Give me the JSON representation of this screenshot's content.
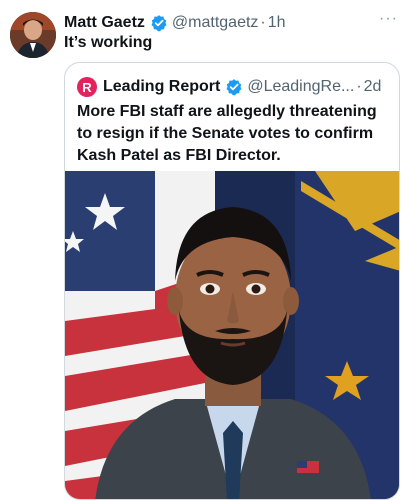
{
  "tweet": {
    "author_name": "Matt Gaetz",
    "handle": "@mattgaetz",
    "separator": "·",
    "age": "1h",
    "text": "It’s working",
    "more_label": "···"
  },
  "quote": {
    "logo_letter": "R",
    "author_name": "Leading Report",
    "handle": "@LeadingRe...",
    "separator": "·",
    "age": "2d",
    "text": "More FBI staff are allegedly threatening to resign if the Senate votes to confirm Kash Patel as FBI Director."
  },
  "colors": {
    "verified_badge": "#1d9bf0",
    "logo_bg": "#e0245e",
    "secondary_text": "#536471",
    "card_border": "#cfd9de"
  },
  "icons": [
    "verified-badge-icon",
    "more-options-icon",
    "leading-report-logo-icon"
  ]
}
